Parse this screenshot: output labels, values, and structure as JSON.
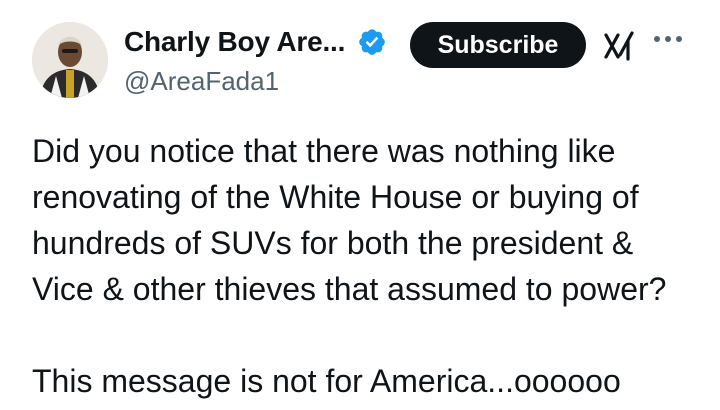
{
  "author": {
    "display_name": "Charly Boy Are...",
    "handle": "@AreaFada1",
    "verified": true,
    "avatar_icon": "profile-photo"
  },
  "actions": {
    "subscribe_label": "Subscribe",
    "grok_icon": "grok-icon",
    "more_icon": "more-icon"
  },
  "tweet": {
    "lines": [
      "Did you notice that there was nothing like",
      "renovating of the White House or buying of",
      "hundreds of SUVs for both the president &",
      "Vice & other thieves that assumed to power?"
    ],
    "closing": "This message is not for America...oooooo"
  },
  "colors": {
    "text": "#0f1419",
    "secondary": "#536471",
    "verified_badge": "#1d9bf0",
    "button_bg": "#0f1419"
  }
}
